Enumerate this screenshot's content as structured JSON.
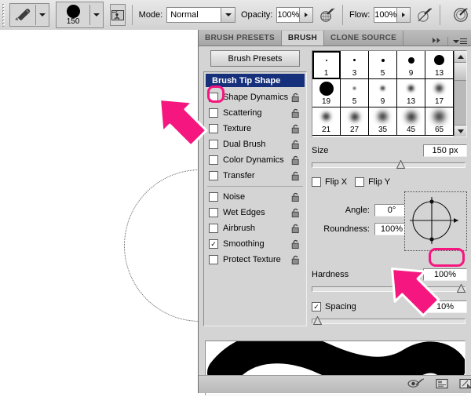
{
  "options_bar": {
    "tool_icon": "brush-tool-icon",
    "tool_preset_caret": "chevron-down-icon",
    "brush_size_label": "150",
    "brush_preview_icon": "brush-tip-preview-icon",
    "toggle_panel_icon": "toggle-brush-panel-icon",
    "mode_label": "Mode:",
    "mode_value": "Normal",
    "opacity_label": "Opacity:",
    "opacity_value": "100%",
    "opacity_pressure_icon": "pressure-opacity-icon",
    "flow_label": "Flow:",
    "flow_value": "100%",
    "flow_pressure_icon": "pressure-flow-icon",
    "airbrush_icon": "airbrush-icon"
  },
  "canvas": {
    "brush_cursor_icon": "brush-cursor-circle"
  },
  "panel": {
    "tabs": [
      {
        "label": "BRUSH PRESETS",
        "active": false
      },
      {
        "label": "BRUSH",
        "active": true
      },
      {
        "label": "CLONE SOURCE",
        "active": false
      }
    ],
    "collapse_icon": "double-chevron-right-icon",
    "menu_icon": "panel-menu-icon",
    "presets_button": "Brush Presets",
    "list": [
      {
        "label": "Brush Tip Shape",
        "type": "header",
        "checked": false,
        "locked": false
      },
      {
        "label": "Shape Dynamics",
        "type": "item",
        "checked": false,
        "locked": true
      },
      {
        "label": "Scattering",
        "type": "item",
        "checked": false,
        "locked": true
      },
      {
        "label": "Texture",
        "type": "item",
        "checked": false,
        "locked": true
      },
      {
        "label": "Dual Brush",
        "type": "item",
        "checked": false,
        "locked": true
      },
      {
        "label": "Color Dynamics",
        "type": "item",
        "checked": false,
        "locked": true
      },
      {
        "label": "Transfer",
        "type": "item",
        "checked": false,
        "locked": true
      },
      {
        "label": "Noise",
        "type": "item",
        "checked": false,
        "locked": true
      },
      {
        "label": "Wet Edges",
        "type": "item",
        "checked": false,
        "locked": true
      },
      {
        "label": "Airbrush",
        "type": "item",
        "checked": false,
        "locked": true
      },
      {
        "label": "Smoothing",
        "type": "item",
        "checked": true,
        "locked": true
      },
      {
        "label": "Protect Texture",
        "type": "item",
        "checked": false,
        "locked": true
      }
    ],
    "brush_grid": {
      "rows": [
        [
          {
            "caption": "1",
            "dot": 2,
            "blur": 0,
            "selected": true
          },
          {
            "caption": "3",
            "dot": 3,
            "blur": 0,
            "selected": false
          },
          {
            "caption": "5",
            "dot": 4,
            "blur": 0,
            "selected": false
          },
          {
            "caption": "9",
            "dot": 8,
            "blur": 0,
            "selected": false
          },
          {
            "caption": "13",
            "dot": 13,
            "blur": 0,
            "selected": false
          }
        ],
        [
          {
            "caption": "19",
            "dot": 18,
            "blur": 0,
            "selected": false
          },
          {
            "caption": "5",
            "dot": 3,
            "blur": 1,
            "selected": false
          },
          {
            "caption": "9",
            "dot": 5,
            "blur": 2,
            "selected": false
          },
          {
            "caption": "13",
            "dot": 7,
            "blur": 3,
            "selected": false
          },
          {
            "caption": "17",
            "dot": 9,
            "blur": 4,
            "selected": false
          }
        ],
        [
          {
            "caption": "21",
            "dot": 9,
            "blur": 4,
            "selected": false
          },
          {
            "caption": "27",
            "dot": 10,
            "blur": 5,
            "selected": false
          },
          {
            "caption": "35",
            "dot": 11,
            "blur": 5,
            "selected": false
          },
          {
            "caption": "45",
            "dot": 12,
            "blur": 6,
            "selected": false
          },
          {
            "caption": "65",
            "dot": 13,
            "blur": 7,
            "selected": false
          }
        ]
      ],
      "scroll_up_icon": "scroll-up-arrow-icon",
      "scroll_down_icon": "scroll-down-arrow-icon"
    },
    "size": {
      "label": "Size",
      "value": "150 px",
      "slider_pct": 58
    },
    "flip_x": {
      "label": "Flip X",
      "checked": false
    },
    "flip_y": {
      "label": "Flip Y",
      "checked": false
    },
    "angle": {
      "label": "Angle:",
      "value": "0°"
    },
    "roundness": {
      "label": "Roundness:",
      "value": "100%"
    },
    "dial_icon": "brush-angle-dial-icon",
    "hardness": {
      "label": "Hardness",
      "value": "100%",
      "slider_pct": 100
    },
    "spacing": {
      "label": "Spacing",
      "value": "10%",
      "checked": true,
      "slider_pct": 4
    },
    "stroke_preview_icon": "brush-stroke-preview",
    "footer_icons": [
      {
        "name": "toggle-live-tip-brush-preview-icon"
      },
      {
        "name": "create-new-brush-preset-icon"
      },
      {
        "name": "delete-brush-icon"
      }
    ]
  },
  "annotations": {
    "highlight_color": "#f5177f",
    "ring_1_target": "shape-dynamics-checkbox",
    "arrow_1_target": "shape-dynamics-checkbox",
    "ring_2_target": "spacing-value-field",
    "arrow_2_target": "spacing-value-field"
  }
}
